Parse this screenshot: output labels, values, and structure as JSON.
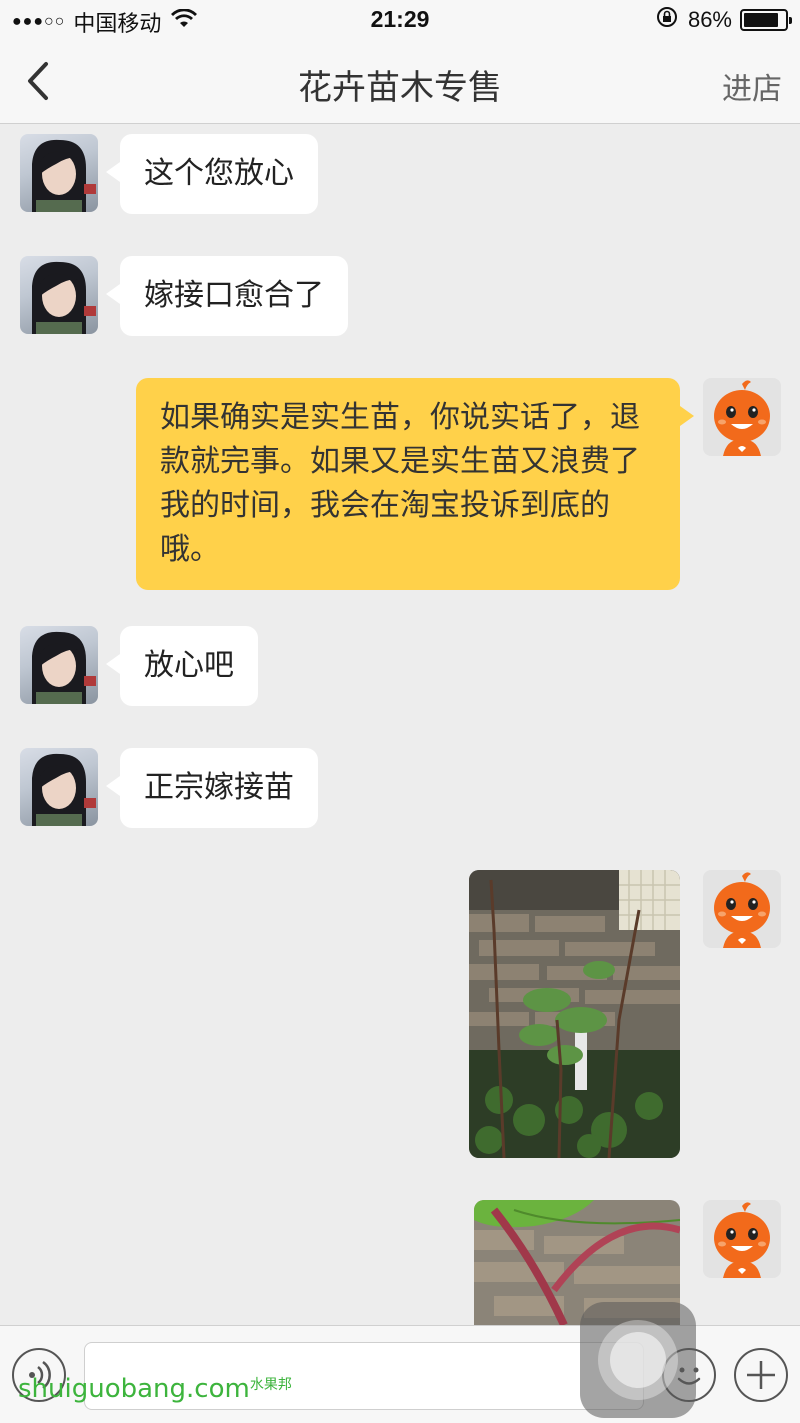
{
  "status_bar": {
    "signal_dots": "●●●○○",
    "carrier": "中国移动",
    "time": "21:29",
    "battery_text": "86%",
    "battery_level": 0.86,
    "wifi_icon": "wifi-icon",
    "lock_icon": "orientation-lock-icon"
  },
  "nav": {
    "title": "花卉苗木专售",
    "right_action": "进店",
    "back_icon": "chevron-left-icon"
  },
  "messages": [
    {
      "side": "left",
      "text": "这个您放心"
    },
    {
      "side": "left",
      "text": "嫁接口愈合了"
    },
    {
      "side": "right",
      "text": "如果确实是实生苗，你说实话了，退款就完事。如果又是实生苗又浪费了我的时间，我会在淘宝投诉到底的哦。"
    },
    {
      "side": "left",
      "text": "放心吧"
    },
    {
      "side": "left",
      "text": "正宗嫁接苗"
    },
    {
      "side": "right",
      "type": "image",
      "description": "plant-photo"
    },
    {
      "side": "right",
      "type": "image",
      "description": "plant-stem-photo"
    }
  ],
  "input_bar": {
    "voice_icon": "voice-icon",
    "emoji_icon": "emoji-icon",
    "plus_icon": "plus-icon"
  },
  "watermark": {
    "text": "shuiguobang.com",
    "small": "水果邦"
  },
  "colors": {
    "outgoing_bubble": "#ffd14a",
    "incoming_bubble": "#ffffff",
    "background": "#ededed",
    "watermark": "#3db43d"
  }
}
